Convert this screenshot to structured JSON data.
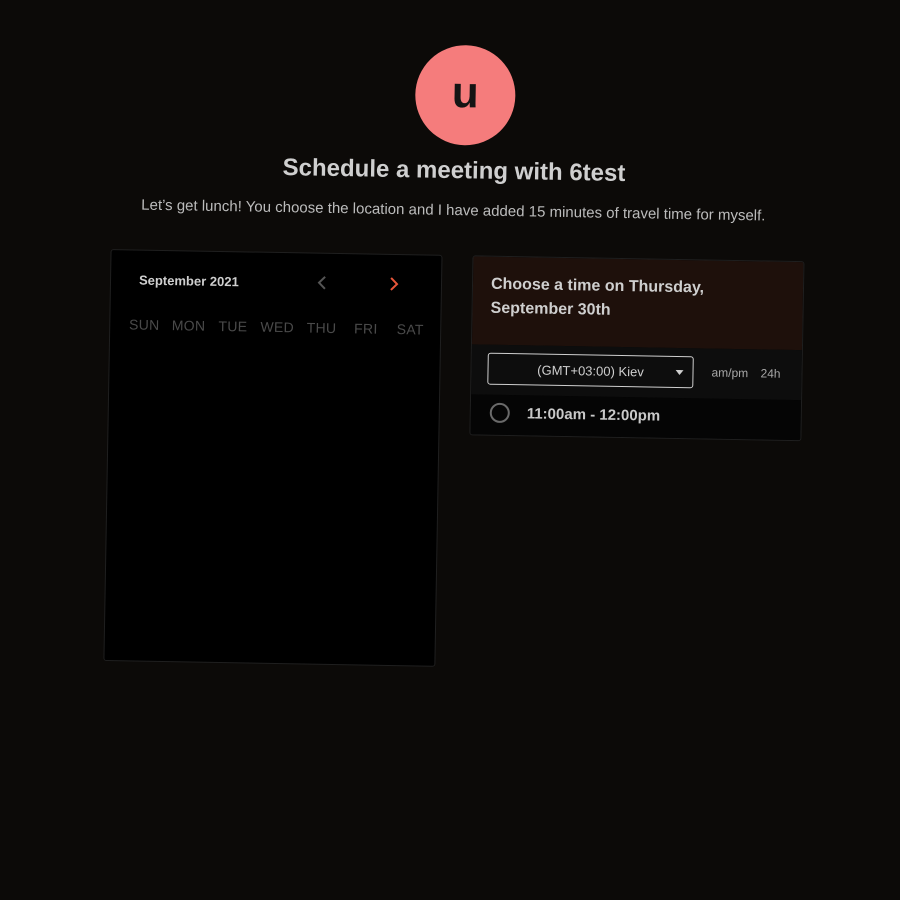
{
  "host": {
    "avatar_letter": "u",
    "avatar_color": "#f57c7c"
  },
  "header": {
    "title": "Schedule a meeting with 6test",
    "description": "Let’s get lunch! You choose the location and I have added 15 minutes of travel time for myself."
  },
  "calendar": {
    "month_label": "September 2021",
    "prev_icon": "chevron-left-icon",
    "next_icon": "chevron-right-icon",
    "accent_color": "#e8563a",
    "weekdays": [
      "SUN",
      "MON",
      "TUE",
      "WED",
      "THU",
      "FRI",
      "SAT"
    ]
  },
  "time_picker": {
    "heading": "Choose a time on Thursday, September 30th",
    "timezone": "(GMT+03:00) Kiev",
    "format_ampm": "am/pm",
    "format_24h": "24h",
    "slots": [
      "11:00am - 12:00pm"
    ]
  }
}
